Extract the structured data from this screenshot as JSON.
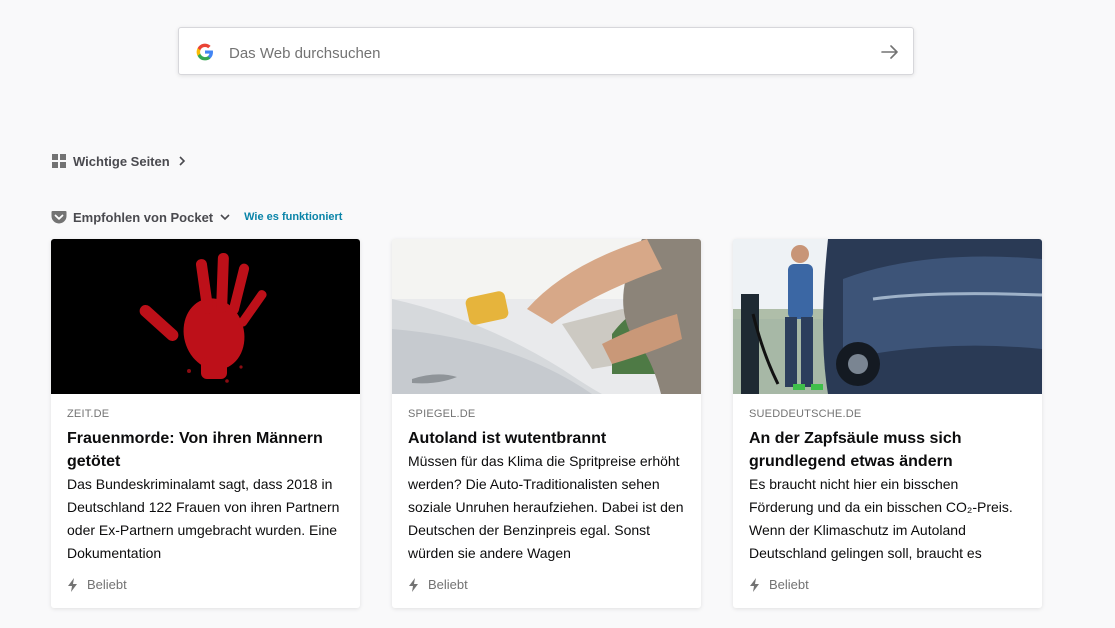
{
  "search": {
    "placeholder": "Das Web durchsuchen"
  },
  "top_sites": {
    "label": "Wichtige Seiten"
  },
  "pocket": {
    "label": "Empfohlen von Pocket",
    "learn_more": "Wie es funktioniert"
  },
  "cards": [
    {
      "source": "ZEIT.DE",
      "title": "Frauenmorde: Von ihren Männern getötet",
      "excerpt": "Das Bundeskriminalamt sagt, dass 2018 in Deutschland 122 Frauen von ihren Partnern oder Ex-Partnern umgebracht wurden. Eine Dokumentation",
      "context": "Beliebt"
    },
    {
      "source": "SPIEGEL.DE",
      "title": "Autoland ist wutentbrannt",
      "excerpt": "Müssen für das Klima die Spritpreise erhöht werden? Die Auto-Traditionalisten sehen soziale Unruhen heraufziehen. Dabei ist den Deutschen der Benzinpreis egal. Sonst würden sie andere Wagen",
      "context": "Beliebt"
    },
    {
      "source": "SUEDDEUTSCHE.DE",
      "title": "An der Zapfsäule muss sich grundlegend etwas ändern",
      "excerpt": "Es braucht nicht hier ein bisschen Förderung und da ein bisschen CO₂-Preis. Wenn der Klimaschutz im Autoland Deutschland gelingen soll, braucht es",
      "context": "Beliebt"
    }
  ]
}
